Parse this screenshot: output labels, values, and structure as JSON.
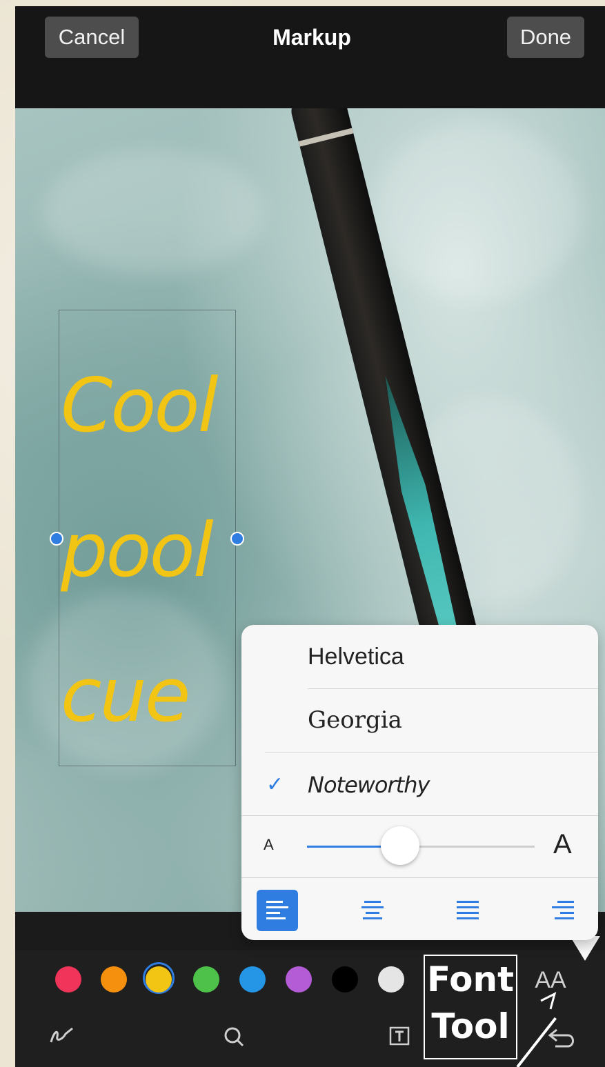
{
  "navbar": {
    "cancel_label": "Cancel",
    "title": "Markup",
    "done_label": "Done"
  },
  "canvas": {
    "text_lines": [
      "Cool",
      "pool",
      "cue"
    ],
    "text_color": "#f2c414"
  },
  "font_popover": {
    "fonts": [
      {
        "label": "Helvetica",
        "selected": false
      },
      {
        "label": "Georgia",
        "selected": false
      },
      {
        "label": "Noteworthy",
        "selected": true
      }
    ],
    "size_small_label": "A",
    "size_large_label": "A",
    "size_level_fraction": 0.41,
    "alignments": [
      {
        "name": "left",
        "active": true
      },
      {
        "name": "center",
        "active": false
      },
      {
        "name": "justify",
        "active": false
      },
      {
        "name": "right",
        "active": false
      }
    ],
    "accent_color": "#2f7de0"
  },
  "toolbar": {
    "colors": [
      "#f0345a",
      "#f5900f",
      "#f2c414",
      "#4ec14a",
      "#2596e6",
      "#b45bd6",
      "#000000",
      "#e5e5e5"
    ],
    "selected_color_index": 2,
    "font_button_label": "AA",
    "icons": [
      "signature-icon",
      "magnifier-icon",
      "text-box-icon",
      "undo-icon"
    ]
  },
  "annotation": {
    "line1": "Font",
    "line2": "Tool"
  }
}
